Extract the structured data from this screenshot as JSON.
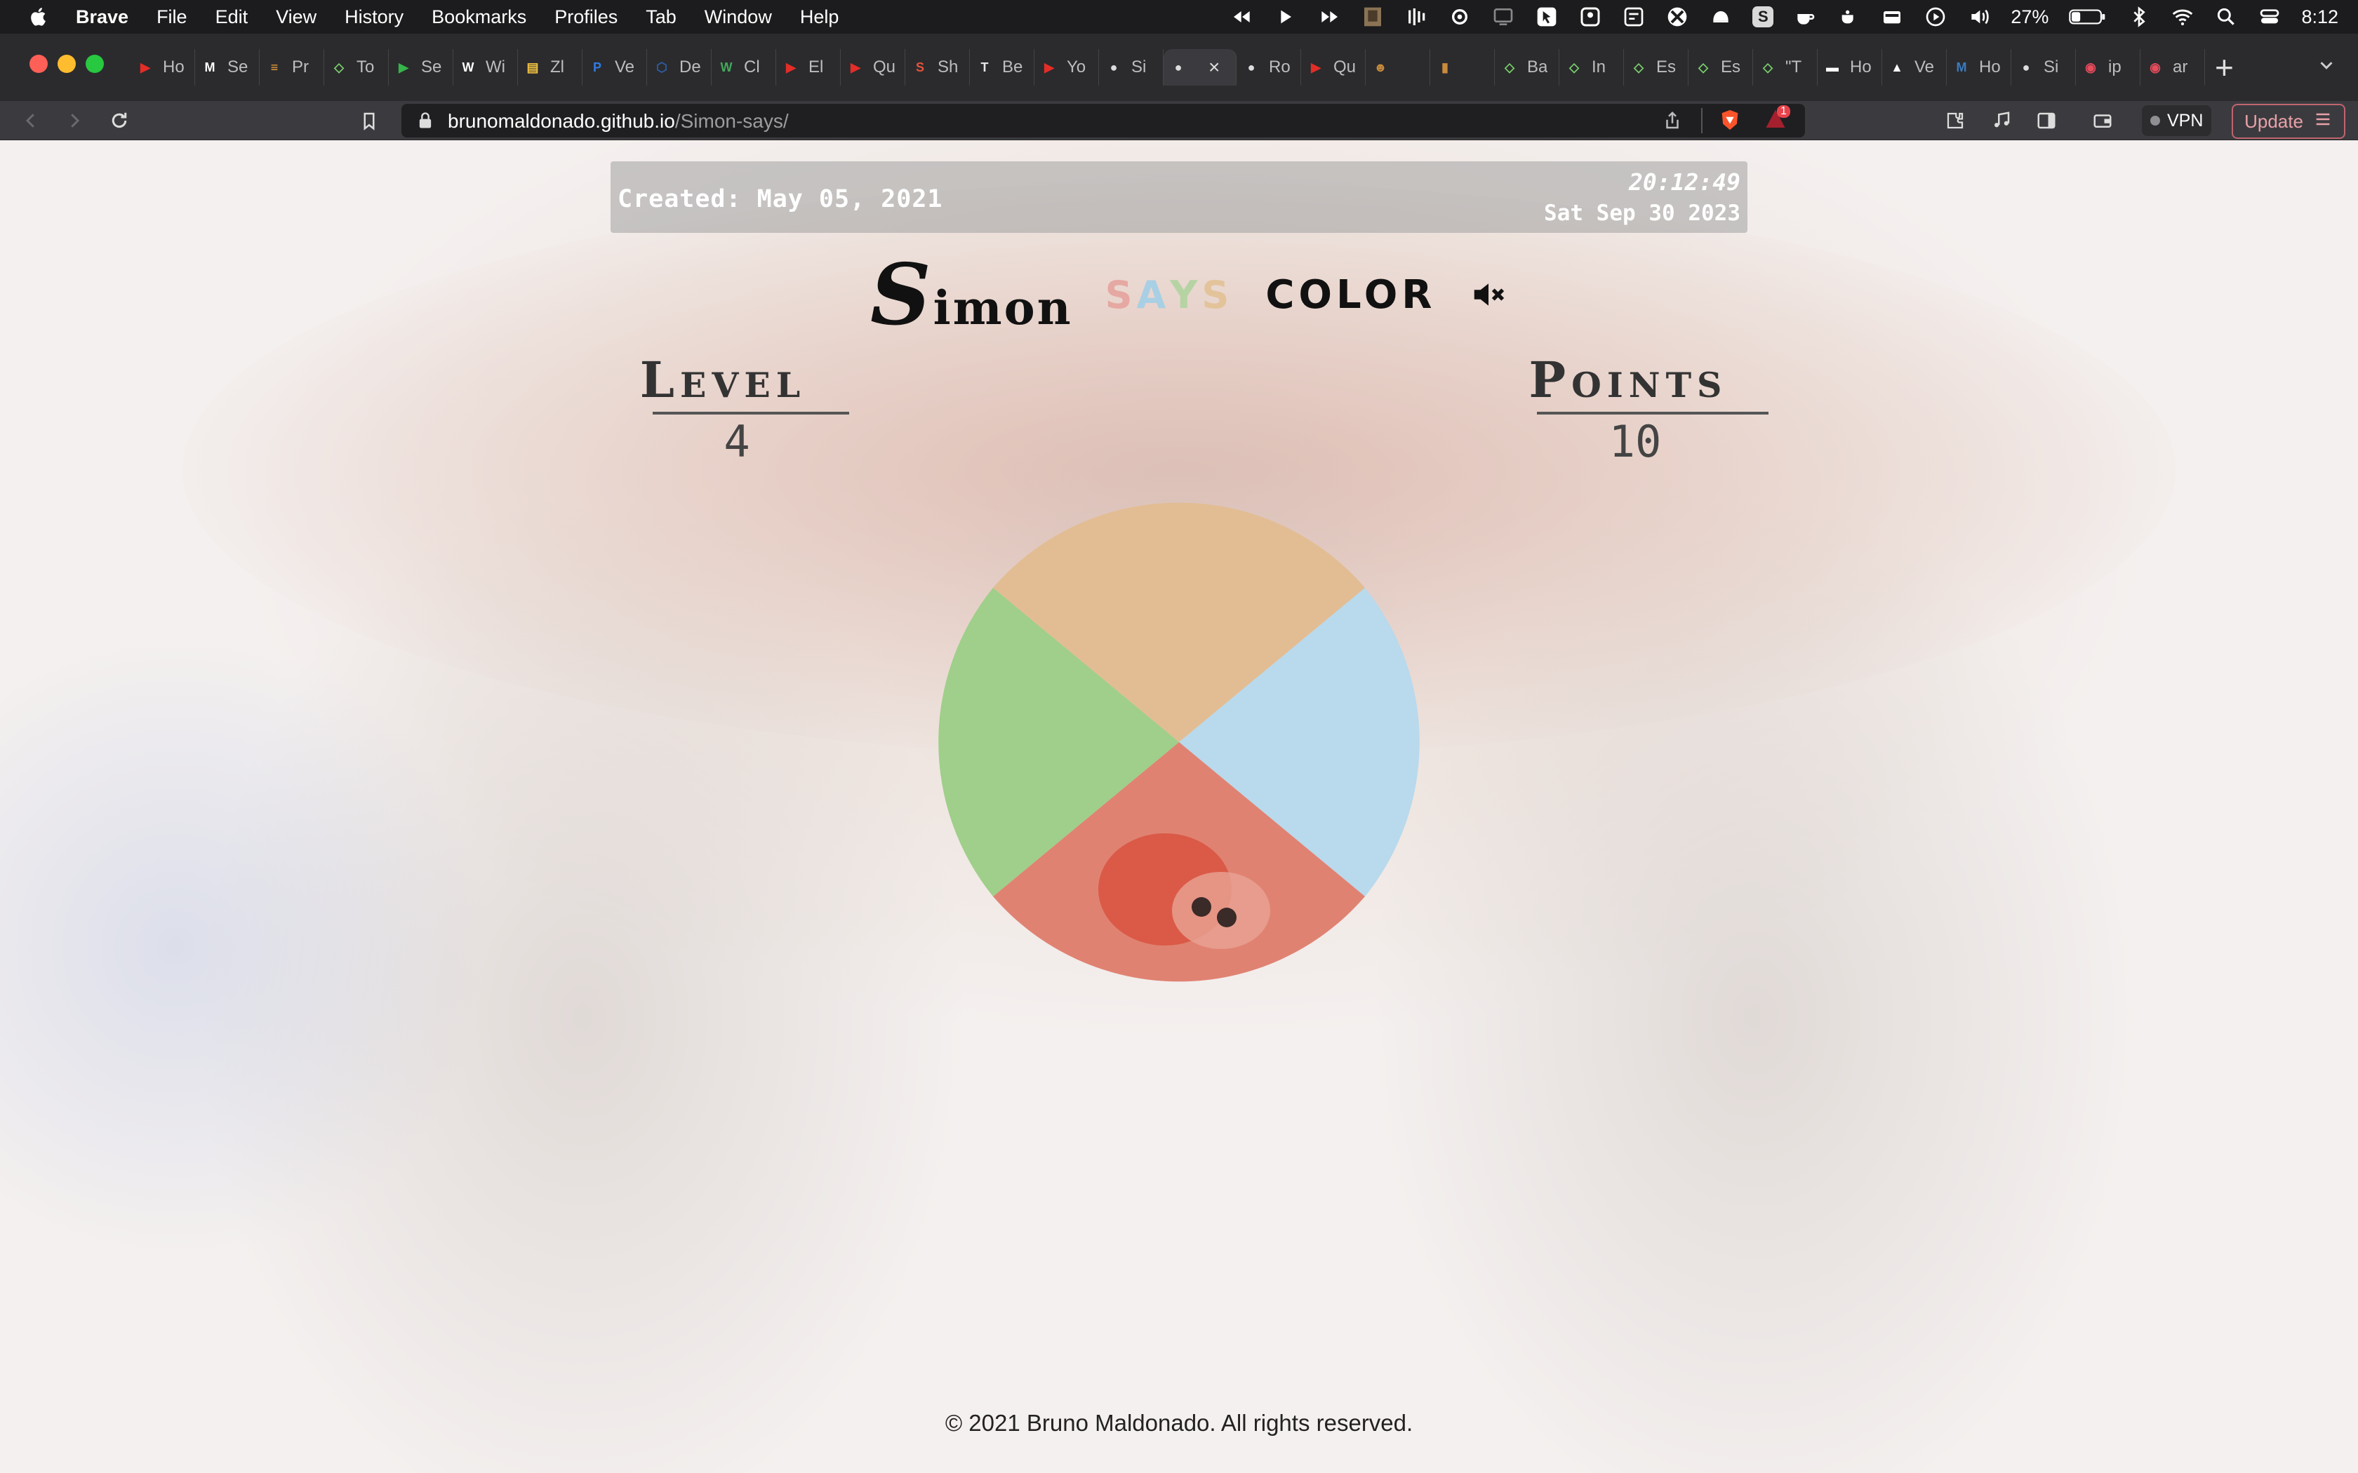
{
  "menubar": {
    "app_name": "Brave",
    "items": [
      "File",
      "Edit",
      "View",
      "History",
      "Bookmarks",
      "Profiles",
      "Tab",
      "Window",
      "Help"
    ],
    "battery": "27%",
    "time": "8:12",
    "status_icons": [
      "rewind-icon",
      "play-icon",
      "fast-forward-icon",
      "app-thumbnail-icon",
      "audio-bars-icon",
      "sync-icon",
      "screen-icon",
      "cursor-icon",
      "notch-icon",
      "grid-icon",
      "xbox-icon",
      "octopus-icon",
      "s-app-icon",
      "coffee-icon",
      "teapot-icon",
      "battery-card-icon",
      "play-circle-icon",
      "volume-icon",
      "battery-icon",
      "bluetooth-icon",
      "wifi-icon",
      "search-icon",
      "control-center-icon"
    ],
    "s_badge": "S"
  },
  "tabs": [
    {
      "label": "Ho",
      "icon": "youtube-icon",
      "color": "#e52d27",
      "glyph": "▶"
    },
    {
      "label": "Se",
      "icon": "gmail-icon",
      "color": "#ffffff",
      "glyph": "M"
    },
    {
      "label": "Pr",
      "icon": "stack-icon",
      "color": "#f2a33a",
      "glyph": "≡"
    },
    {
      "label": "To",
      "icon": "diamond-icon",
      "color": "#7ad36a",
      "glyph": "◇"
    },
    {
      "label": "Se",
      "icon": "play-circle-icon",
      "color": "#35b54a",
      "glyph": "▶"
    },
    {
      "label": "Wi",
      "icon": "wiki-icon",
      "color": "#ffffff",
      "glyph": "W"
    },
    {
      "label": "Zl",
      "icon": "folder-icon",
      "color": "#f5c542",
      "glyph": "▤"
    },
    {
      "label": "Ve",
      "icon": "p-icon",
      "color": "#2f7be5",
      "glyph": "P"
    },
    {
      "label": "De",
      "icon": "hex-icon",
      "color": "#2d5fa8",
      "glyph": "⬡"
    },
    {
      "label": "Cl",
      "icon": "w-icon",
      "color": "#42a95b",
      "glyph": "W"
    },
    {
      "label": "El",
      "icon": "youtube-icon",
      "color": "#e52d27",
      "glyph": "▶"
    },
    {
      "label": "Qu",
      "icon": "youtube-icon",
      "color": "#e52d27",
      "glyph": "▶"
    },
    {
      "label": "Sh",
      "icon": "s-icon",
      "color": "#e4533b",
      "glyph": "S"
    },
    {
      "label": "Be",
      "icon": "tt-icon",
      "color": "#e6e6e6",
      "glyph": "T"
    },
    {
      "label": "Yo",
      "icon": "youtube-icon",
      "color": "#e52d27",
      "glyph": "▶"
    },
    {
      "label": "Si",
      "icon": "circle-icon",
      "color": "#dcdcdc",
      "glyph": "●"
    },
    {
      "label": "",
      "icon": "circle-icon",
      "color": "#dcdcdc",
      "glyph": "●",
      "active": true
    },
    {
      "label": "Ro",
      "icon": "circle-icon",
      "color": "#dcdcdc",
      "glyph": "●"
    },
    {
      "label": "Qu",
      "icon": "youtube-icon",
      "color": "#e52d27",
      "glyph": "▶"
    },
    {
      "label": "",
      "icon": "cat-icon",
      "color": "#c58a3c",
      "glyph": "☻"
    },
    {
      "label": "",
      "icon": "book-icon",
      "color": "#c98a3b",
      "glyph": "▮"
    },
    {
      "label": "Ba",
      "icon": "diamond-icon",
      "color": "#7ad36a",
      "glyph": "◇"
    },
    {
      "label": "In",
      "icon": "diamond-icon",
      "color": "#7ad36a",
      "glyph": "◇"
    },
    {
      "label": "Es",
      "icon": "diamond-icon",
      "color": "#7ad36a",
      "glyph": "◇"
    },
    {
      "label": "Es",
      "icon": "diamond-icon",
      "color": "#7ad36a",
      "glyph": "◇"
    },
    {
      "label": "\"T",
      "icon": "diamond-icon",
      "color": "#7ad36a",
      "glyph": "◇"
    },
    {
      "label": "Ho",
      "icon": "chat-icon",
      "color": "#ffffff",
      "glyph": "▬"
    },
    {
      "label": "Ve",
      "icon": "triangle-icon",
      "color": "#ffffff",
      "glyph": "▲"
    },
    {
      "label": "Ho",
      "icon": "m-icon",
      "color": "#3b7bbf",
      "glyph": "M"
    },
    {
      "label": "Si",
      "icon": "circle-icon",
      "color": "#dcdcdc",
      "glyph": "●"
    },
    {
      "label": "ip",
      "icon": "record-icon",
      "color": "#e64c5c",
      "glyph": "◉"
    },
    {
      "label": "ar",
      "icon": "record-icon",
      "color": "#e64c5c",
      "glyph": "◉"
    }
  ],
  "address": {
    "host": "brunomaldonado.github.io",
    "path": "/Simon-says/",
    "vpn_label": "VPN",
    "update_label": "Update",
    "alerts_badge": "1"
  },
  "page": {
    "created": "Created: May 05, 2021",
    "clock_time": "20:12:49",
    "clock_date": "Sat Sep 30 2023",
    "title_simon_initial": "S",
    "title_simon_rest": "imon",
    "title_says": [
      "S",
      "A",
      "Y",
      "S"
    ],
    "title_color": "COLOR",
    "level_label": "Level",
    "level_value": "4",
    "points_label": "Points",
    "points_value": "10",
    "footer": "© 2021 Bruno Maldonado. All rights reserved.",
    "sound_icon": "speaker-muted-icon"
  },
  "board": {
    "colors": {
      "top": "#e2bd93",
      "right": "#b9d9ec",
      "bottom": "#e08272",
      "left": "#9fcf8a"
    },
    "pad_names": [
      "orange-pad",
      "blue-pad",
      "red-pad",
      "green-pad"
    ]
  }
}
